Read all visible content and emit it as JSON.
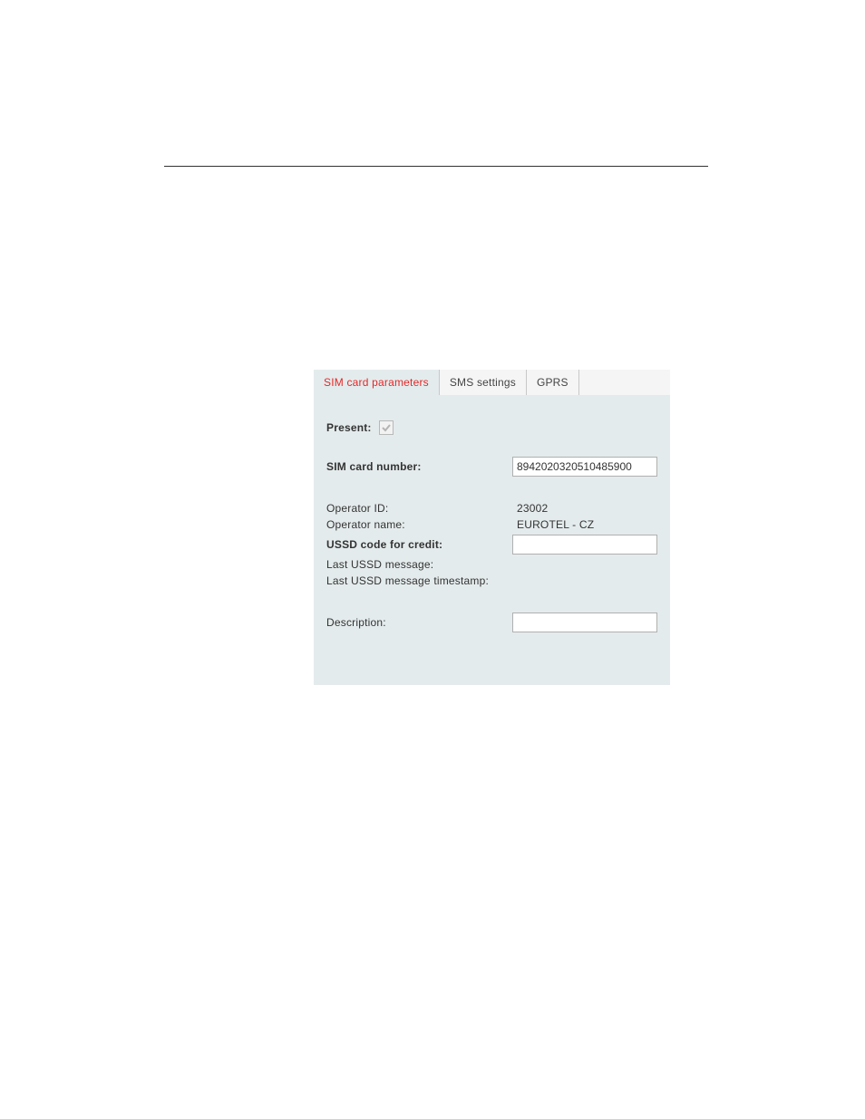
{
  "tabs": {
    "sim": "SIM card parameters",
    "sms": "SMS settings",
    "gprs": "GPRS"
  },
  "form": {
    "present_label": "Present:",
    "present_checked": true,
    "sim_number_label": "SIM card number:",
    "sim_number_value": "8942020320510485900",
    "operator_id_label": "Operator ID:",
    "operator_id_value": "23002",
    "operator_name_label": "Operator name:",
    "operator_name_value": "EUROTEL - CZ",
    "ussd_code_label": "USSD code for credit:",
    "ussd_code_value": "",
    "last_ussd_label": "Last USSD message:",
    "last_ussd_value": "",
    "last_ussd_ts_label": "Last USSD message timestamp:",
    "last_ussd_ts_value": "",
    "description_label": "Description:",
    "description_value": ""
  }
}
